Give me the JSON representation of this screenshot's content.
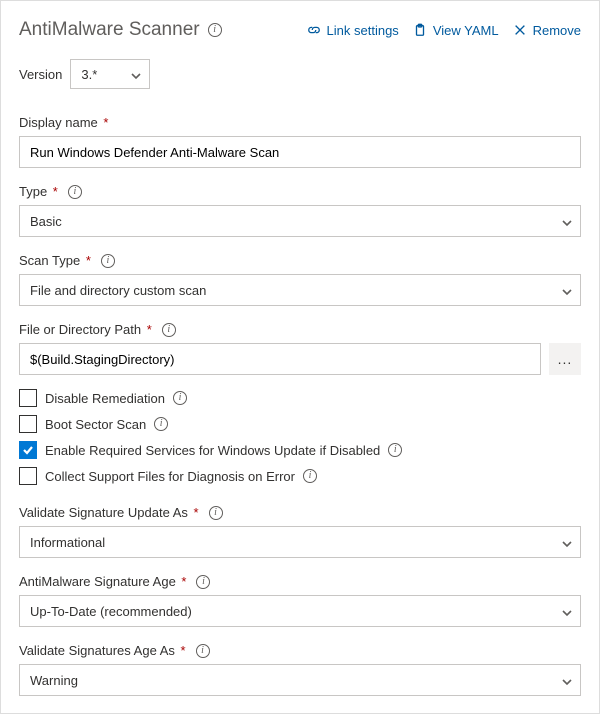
{
  "header": {
    "title": "AntiMalware Scanner",
    "actions": {
      "link_settings": "Link settings",
      "view_yaml": "View YAML",
      "remove": "Remove"
    }
  },
  "version": {
    "label": "Version",
    "value": "3.*"
  },
  "fields": {
    "display_name": {
      "label": "Display name",
      "value": "Run Windows Defender Anti-Malware Scan"
    },
    "type": {
      "label": "Type",
      "value": "Basic"
    },
    "scan_type": {
      "label": "Scan Type",
      "value": "File and directory custom scan"
    },
    "file_path": {
      "label": "File or Directory Path",
      "value": "$(Build.StagingDirectory)"
    },
    "validate_signature_update_as": {
      "label": "Validate Signature Update As",
      "value": "Informational"
    },
    "signature_age": {
      "label": "AntiMalware Signature Age",
      "value": "Up-To-Date (recommended)"
    },
    "validate_signatures_age_as": {
      "label": "Validate Signatures Age As",
      "value": "Warning"
    }
  },
  "checkboxes": {
    "disable_remediation": {
      "label": "Disable Remediation",
      "checked": false
    },
    "boot_sector": {
      "label": "Boot Sector Scan",
      "checked": false
    },
    "enable_services": {
      "label": "Enable Required Services for Windows Update if Disabled",
      "checked": true
    },
    "collect_support": {
      "label": "Collect Support Files for Diagnosis on Error",
      "checked": false
    }
  },
  "more_button": "..."
}
